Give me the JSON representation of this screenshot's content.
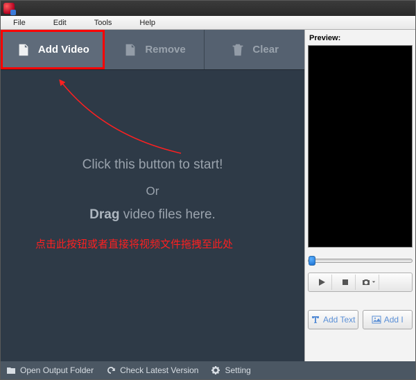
{
  "menu": {
    "file": "File",
    "edit": "Edit",
    "tools": "Tools",
    "help": "Help"
  },
  "toolbar": {
    "add_video": "Add Video",
    "remove": "Remove",
    "clear": "Clear"
  },
  "drop_hint": {
    "line1": "Click this button to start!",
    "or": "Or",
    "line2_bold": "Drag",
    "line2_rest": " video files here."
  },
  "annotation": "点击此按钮或者直接将视频文件拖拽至此处",
  "preview": {
    "label": "Preview:"
  },
  "actions": {
    "add_text": "Add Text",
    "add_image": "Add I"
  },
  "bottom": {
    "open_output": "Open Output Folder",
    "check_version": "Check Latest Version",
    "setting": "Setting"
  }
}
